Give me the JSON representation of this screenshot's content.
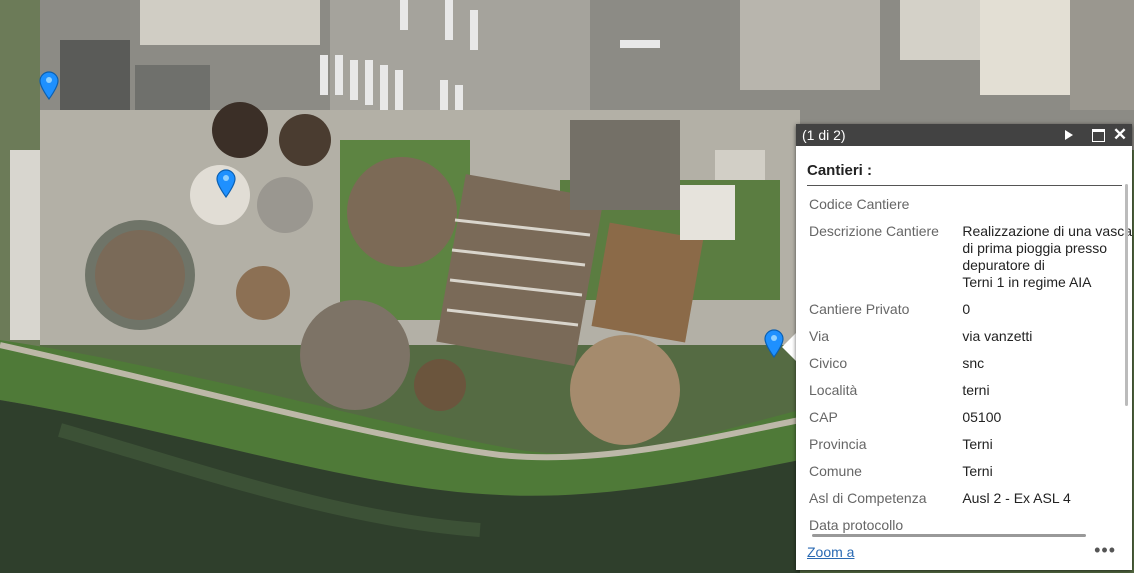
{
  "map": {
    "colors": {
      "grass": "#4b6a35",
      "concrete": "#c9c6bd",
      "water": "#2d3e2c",
      "tank_sludge": "#8a6f55",
      "pin": "#1e90ff"
    }
  },
  "popup": {
    "count": "(1 di 2)",
    "title": "Cantieri :",
    "fields": [
      {
        "name": "Codice Cantiere",
        "value": ""
      },
      {
        "name": "Descrizione Cantiere",
        "value_lines": [
          "Realizzazione di una vasca",
          "di prima pioggia presso",
          "depuratore di",
          "Terni 1 in regime AIA"
        ]
      },
      {
        "name": "Cantiere Privato",
        "value": "0"
      },
      {
        "name": "Via",
        "value": "via vanzetti"
      },
      {
        "name": "Civico",
        "value": "snc"
      },
      {
        "name": "Località",
        "value": "terni"
      },
      {
        "name": "CAP",
        "value": "05100"
      },
      {
        "name": "Provincia",
        "value": "Terni"
      },
      {
        "name": "Comune",
        "value": "Terni"
      },
      {
        "name": "Asl di Competenza",
        "value": "Ausl 2 - Ex ASL 4"
      },
      {
        "name": "Data protocollo",
        "value": ""
      }
    ],
    "zoom_label": "Zoom a",
    "more_label": "•••",
    "icons": {
      "next": "play-icon",
      "maximize": "maximize-icon",
      "close": "close-icon"
    }
  }
}
